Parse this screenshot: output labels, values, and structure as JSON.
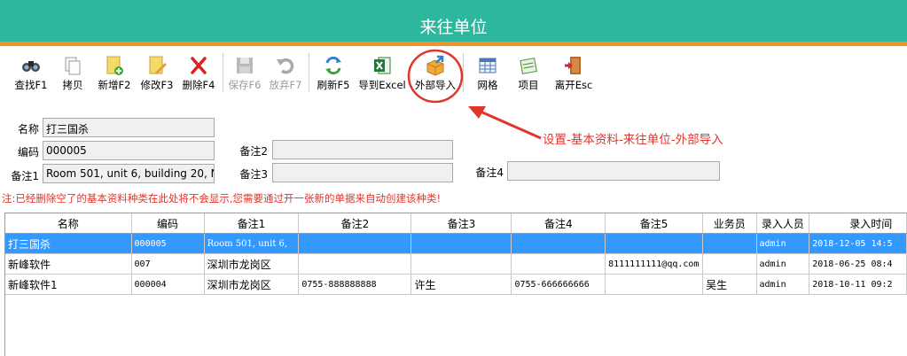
{
  "window": {
    "title": "来往单位",
    "header_color": "#2db79f",
    "accent_color": "#f39124"
  },
  "toolbar": {
    "buttons": [
      {
        "label": "查找F1",
        "icon": "binoculars-icon",
        "enabled": true
      },
      {
        "label": "拷贝",
        "icon": "copy-icon",
        "enabled": true
      },
      {
        "label": "新增F2",
        "icon": "new-document-icon",
        "enabled": true
      },
      {
        "label": "修改F3",
        "icon": "edit-icon",
        "enabled": true
      },
      {
        "label": "删除F4",
        "icon": "delete-x-icon",
        "enabled": true
      },
      {
        "label": "保存F6",
        "icon": "save-icon",
        "enabled": false
      },
      {
        "label": "放弃F7",
        "icon": "undo-icon",
        "enabled": false
      },
      {
        "label": "刷新F5",
        "icon": "refresh-icon",
        "enabled": true
      },
      {
        "label": "导到Excel",
        "icon": "excel-icon",
        "enabled": true
      },
      {
        "label": "外部导入",
        "icon": "import-box-icon",
        "enabled": true
      },
      {
        "label": "网格",
        "icon": "grid-icon",
        "enabled": true
      },
      {
        "label": "项目",
        "icon": "project-icon",
        "enabled": true
      },
      {
        "label": "离开Esc",
        "icon": "exit-door-icon",
        "enabled": true
      }
    ]
  },
  "annotation": {
    "text": "设置-基本资料-来往单位-外部导入",
    "color": "#e0352b"
  },
  "form": {
    "name_label": "名称",
    "name_value": "打三国杀",
    "code_label": "编码",
    "code_value": "000005",
    "note1_label": "备注1",
    "note1_value": "Room 501, unit 6, building 20, N",
    "note2_label": "备注2",
    "note2_value": "",
    "note3_label": "备注3",
    "note3_value": "",
    "note4_label": "备注4",
    "note4_value": ""
  },
  "warning": "注:已经删除空了的基本资料种类在此处将不会显示,您需要通过开一张新的单据来自动创建该种类!",
  "table": {
    "columns": [
      "名称",
      "编码",
      "备注1",
      "备注2",
      "备注3",
      "备注4",
      "备注5",
      "业务员",
      "录入人员",
      "录入时间"
    ],
    "rows": [
      {
        "selected": true,
        "cells": [
          "打三国杀",
          "000005",
          "Room 501, unit 6,",
          "",
          "",
          "",
          "",
          "",
          "admin",
          "2018-12-05 14:5"
        ]
      },
      {
        "selected": false,
        "cells": [
          "新峰软件",
          "007",
          "深圳市龙岗区",
          "",
          "",
          "",
          "8111111111@qq.com",
          "",
          "admin",
          "2018-06-25 08:4"
        ]
      },
      {
        "selected": false,
        "cells": [
          "新峰软件1",
          "000004",
          "深圳市龙岗区",
          "0755-888888888",
          "许生",
          "0755-666666666",
          "",
          "吴生",
          "admin",
          "2018-10-11 09:2"
        ]
      }
    ]
  }
}
